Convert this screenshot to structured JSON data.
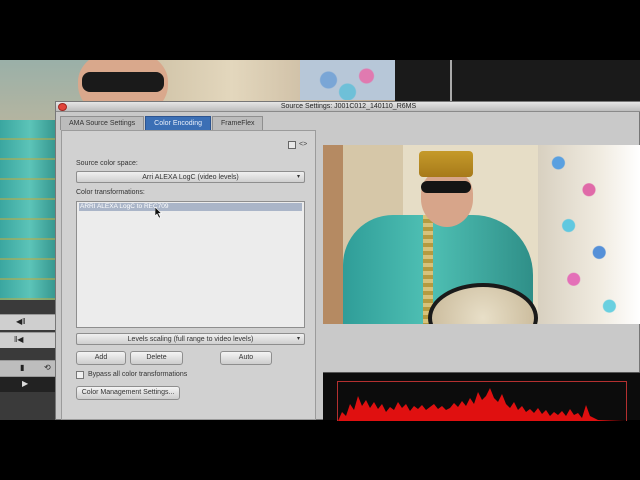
{
  "window": {
    "title": "Source Settings: J001C012_140110_R6MS"
  },
  "tabs": [
    {
      "label": "AMA Source Settings",
      "active": false
    },
    {
      "label": "Color Encoding",
      "active": true
    },
    {
      "label": "FrameFlex",
      "active": false
    }
  ],
  "color_encoding": {
    "source_color_space_label": "Source color space:",
    "source_color_space_value": "Arri ALEXA LogC (video levels)",
    "color_transformations_label": "Color transformations:",
    "transformations": [
      "ARRI ALEXA LogC to REC709"
    ],
    "levels_scaling_value": "Levels scaling (full range to video levels)",
    "add_label": "Add",
    "delete_label": "Delete",
    "auto_label": "Auto",
    "bypass_label": "Bypass all color transformations",
    "bypass_checked": false,
    "color_management_label": "Color Management Settings..."
  },
  "colors": {
    "active_tab": "#3b6fb5",
    "histogram": "#e01010",
    "close_button": "#e2453b"
  },
  "icons": [
    "close-icon",
    "toggle-box-icon",
    "code-arrows-icon",
    "dropdown-arrow-icon",
    "pointer-cursor-icon"
  ]
}
